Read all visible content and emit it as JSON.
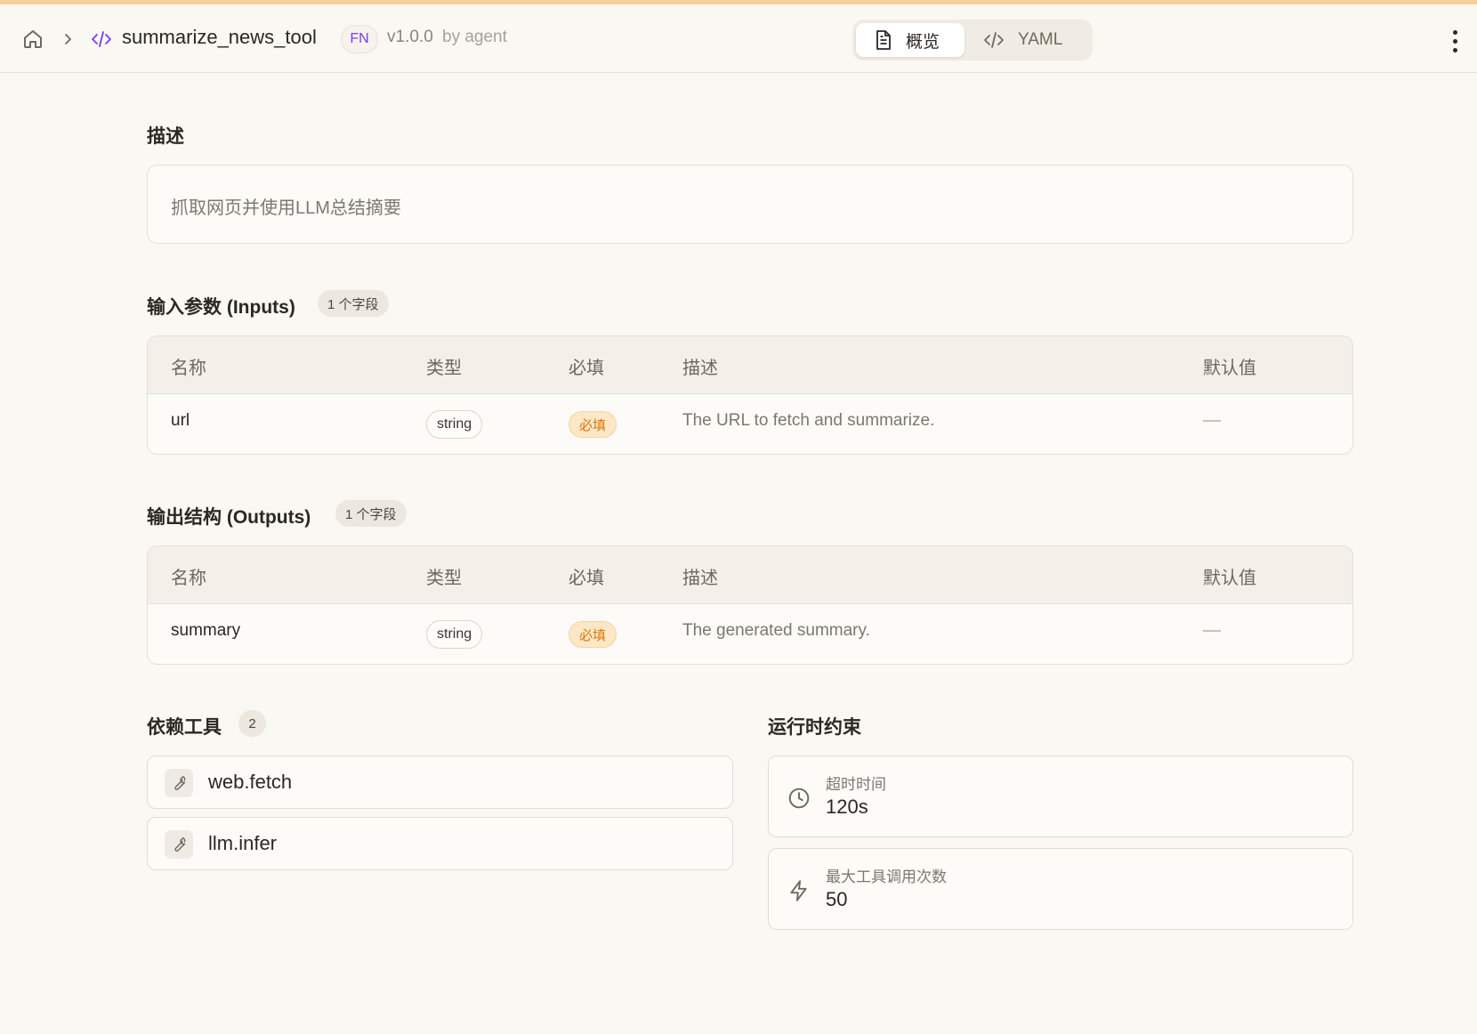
{
  "header": {
    "tool_name": "summarize_news_tool",
    "kind_badge": "FN",
    "version": "v1.0.0",
    "author": "by agent",
    "tabs": [
      {
        "label": "概览",
        "icon": "document-icon",
        "active": true
      },
      {
        "label": "YAML",
        "icon": "code-icon",
        "active": false
      }
    ]
  },
  "description": {
    "title": "描述",
    "text": "抓取网页并使用LLM总结摘要"
  },
  "inputs": {
    "title": "输入参数 (Inputs)",
    "count_badge": "1 个字段",
    "columns": [
      "名称",
      "类型",
      "必填",
      "描述",
      "默认值"
    ],
    "rows": [
      {
        "name": "url",
        "type": "string",
        "required": "必填",
        "description": "The URL to fetch and summarize.",
        "default": "—"
      }
    ]
  },
  "outputs": {
    "title": "输出结构 (Outputs)",
    "count_badge": "1 个字段",
    "columns": [
      "名称",
      "类型",
      "必填",
      "描述",
      "默认值"
    ],
    "rows": [
      {
        "name": "summary",
        "type": "string",
        "required": "必填",
        "description": "The generated summary.",
        "default": "—"
      }
    ]
  },
  "dependencies": {
    "title": "依赖工具",
    "count": "2",
    "items": [
      {
        "label": "web.fetch",
        "icon": "wrench-icon"
      },
      {
        "label": "llm.infer",
        "icon": "wrench-icon"
      }
    ]
  },
  "runtime": {
    "title": "运行时约束",
    "items": [
      {
        "label": "超时时间",
        "value": "120s",
        "icon": "clock-icon"
      },
      {
        "label": "最大工具调用次数",
        "value": "50",
        "icon": "lightning-icon"
      }
    ]
  },
  "colors": {
    "accent_purple": "#7c3aed",
    "required_orange": "#d9770f",
    "background": "#faf8f3"
  }
}
